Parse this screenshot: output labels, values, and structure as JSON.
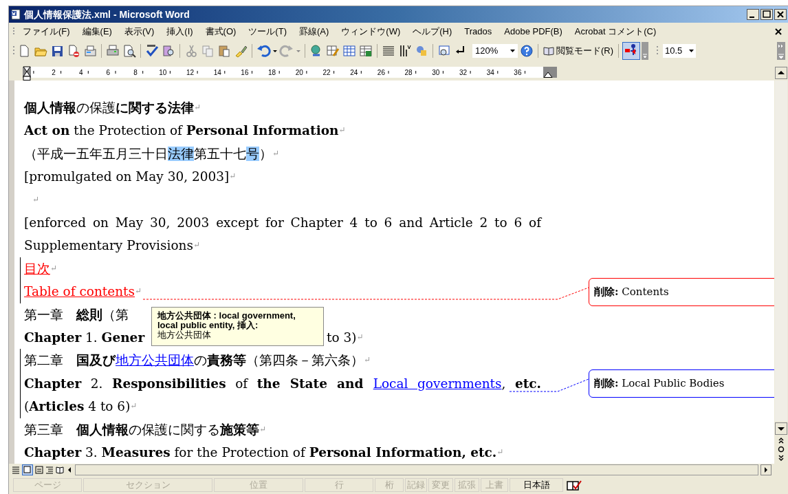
{
  "window": {
    "title": "個人情報保護法.xml - Microsoft Word"
  },
  "menu": [
    "ファイル(F)",
    "編集(E)",
    "表示(V)",
    "挿入(I)",
    "書式(O)",
    "ツール(T)",
    "罫線(A)",
    "ウィンドウ(W)",
    "ヘルプ(H)",
    "Trados",
    "Adobe PDF(B)",
    "Acrobat コメント(C)"
  ],
  "toolbar": {
    "zoom": "120%",
    "reading_mode": "閲覧モード(R)",
    "font_size": "10.5"
  },
  "ruler": {
    "labels": [
      "2",
      "4",
      "6",
      "8",
      "10",
      "12",
      "14",
      "16",
      "18",
      "20",
      "22",
      "24",
      "26",
      "28",
      "30",
      "32",
      "34",
      "36"
    ]
  },
  "document": {
    "paragraphs": [
      {
        "segments": [
          {
            "kind": "bold",
            "text": "個人情報"
          },
          {
            "kind": "plain",
            "text": "の保護"
          },
          {
            "kind": "bold",
            "text": "に関する法律"
          }
        ],
        "end_mark": "↵",
        "change_bar": false
      },
      {
        "segments": [
          {
            "kind": "bold",
            "text": "Act on"
          },
          {
            "kind": "plain",
            "text": " the Protection of "
          },
          {
            "kind": "bold",
            "text": "Personal Information"
          }
        ],
        "end_mark": "↵",
        "change_bar": false
      },
      {
        "segments": [
          {
            "kind": "plain",
            "text": "（平成一五年五月三十日"
          },
          {
            "kind": "highlight",
            "text": "法律"
          },
          {
            "kind": "plain",
            "text": "第五十七"
          },
          {
            "kind": "highlight",
            "text": "号"
          },
          {
            "kind": "plain",
            "text": "）"
          }
        ],
        "end_mark": "↵",
        "change_bar": false
      },
      {
        "segments": [
          {
            "kind": "plain",
            "text": "[promulgated on May 30, 2003]"
          }
        ],
        "end_mark": "↵",
        "change_bar": false
      },
      {
        "end_mark": "↵",
        "change_bar": false
      },
      {
        "segments": [
          {
            "kind": "plain",
            "text": "[enforced on May 30, 2003 except for Chapter 4 to 6 and Article 2 to 6 of Supplementary Provisions"
          }
        ],
        "end_mark": "↵",
        "change_bar": false
      },
      {
        "segments": [
          {
            "kind": "inserted",
            "text": "目次",
            "color": "#ff0000"
          }
        ],
        "end_mark": "↵",
        "change_bar": true
      },
      {
        "segments": [
          {
            "kind": "inserted",
            "text": "Table of contents",
            "color": "#ff0000"
          }
        ],
        "end_mark": "↵",
        "change_bar": true
      },
      {
        "segments": [
          {
            "kind": "plain",
            "text": "第一章　"
          },
          {
            "kind": "bold",
            "text": "総則"
          },
          {
            "kind": "plain",
            "text": "（第"
          }
        ],
        "change_bar": false
      },
      {
        "segments": [
          {
            "kind": "bold",
            "text": "Chapter"
          },
          {
            "kind": "plain",
            "text": " 1. "
          },
          {
            "kind": "bold",
            "text": "Gener"
          }
        ],
        "after_segments": [
          {
            "kind": "plain",
            "text": "to 3)"
          }
        ],
        "end_mark": "↵",
        "change_bar": false
      },
      {
        "segments": [
          {
            "kind": "plain",
            "text": "第二章　"
          },
          {
            "kind": "bold",
            "text": "国及び"
          },
          {
            "kind": "inserted",
            "text": "地方公共団体",
            "color": "#0000ff"
          },
          {
            "kind": "plain",
            "text": "の"
          },
          {
            "kind": "bold",
            "text": "責務等"
          },
          {
            "kind": "plain",
            "text": "（第四条－第六条）"
          }
        ],
        "end_mark": "↵",
        "change_bar": true
      },
      {
        "segments": [
          {
            "kind": "bold",
            "text": "Chapter"
          },
          {
            "kind": "plain",
            "text": " 2. "
          },
          {
            "kind": "bold",
            "text": "Responsibilities"
          },
          {
            "kind": "plain",
            "text": " of "
          },
          {
            "kind": "bold",
            "text": "the State and "
          },
          {
            "kind": "inserted",
            "text": "Local governments",
            "color": "#0000ff"
          },
          {
            "kind": "plain",
            "text": ", "
          },
          {
            "kind": "bold",
            "text": "etc."
          },
          {
            "kind": "plain",
            "text": " ("
          },
          {
            "kind": "bold",
            "text": "Articles"
          },
          {
            "kind": "plain",
            "text": " 4 to 6)"
          }
        ],
        "end_mark": "↵",
        "change_bar": true
      },
      {
        "segments": [
          {
            "kind": "plain",
            "text": "第三章　"
          },
          {
            "kind": "bold",
            "text": "個人情報"
          },
          {
            "kind": "plain",
            "text": "の保護に関する"
          },
          {
            "kind": "bold",
            "text": "施策等"
          }
        ],
        "end_mark": "↵",
        "change_bar": false
      },
      {
        "segments": [
          {
            "kind": "bold",
            "text": "Chapter"
          },
          {
            "kind": "plain",
            "text": " 3. "
          },
          {
            "kind": "bold",
            "text": "Measures"
          },
          {
            "kind": "plain",
            "text": " for the Protection of "
          },
          {
            "kind": "bold",
            "text": "Personal Information, etc."
          }
        ],
        "end_mark": "↵",
        "change_bar": false
      }
    ],
    "balloons": [
      {
        "text": "**削除:** Contents",
        "color": "#ff0000"
      },
      {
        "text": "**削除:** Local Public Bodies",
        "color": "#0000ff"
      }
    ],
    "tooltip": {
      "heading": "地方公共団体 : local government, local public entity, 挿入:",
      "text": "地方公共団体"
    }
  },
  "status_bar": [
    {
      "label": "ページ",
      "disabled": true
    },
    {
      "label": "セクション",
      "disabled": true
    },
    {
      "label": "位置",
      "disabled": true
    },
    {
      "label": "行",
      "disabled": true
    },
    {
      "label": "桁",
      "disabled": true
    },
    {
      "label": "記録",
      "disabled": true
    },
    {
      "label": "変更",
      "disabled": true
    },
    {
      "label": "拡張",
      "disabled": true
    },
    {
      "label": "上書",
      "disabled": true
    },
    {
      "label": "日本語",
      "disabled": false
    }
  ]
}
